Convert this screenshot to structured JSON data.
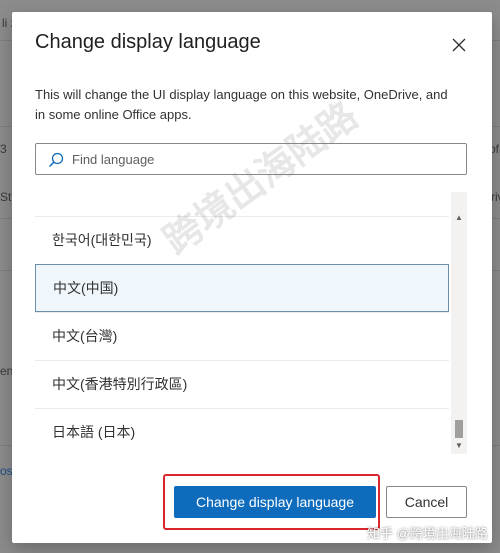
{
  "background": {
    "fragments": [
      "li z",
      "3",
      "Sta",
      "en",
      "os",
      "of",
      "riv"
    ]
  },
  "dialog": {
    "title": "Change display language",
    "description": "This will change the UI display language on this website, OneDrive, and in some online Office apps.",
    "search": {
      "placeholder": "Find language",
      "value": ""
    },
    "languages": [
      {
        "label": "한국어(대한민국)",
        "selected": false
      },
      {
        "label": "中文(中国)",
        "selected": true
      },
      {
        "label": "中文(台灣)",
        "selected": false
      },
      {
        "label": "中文(香港特別行政區)",
        "selected": false
      },
      {
        "label": "日本語 (日本)",
        "selected": false
      }
    ],
    "primary_button": "Change display language",
    "cancel_button": "Cancel"
  },
  "overlay": {
    "watermark": "跨境出海陆路",
    "credit": "知乎 @跨境出海陆路",
    "highlight_color": "#d9262b"
  },
  "colors": {
    "accent": "#0f6cbd",
    "selected_bg": "#eff6fc",
    "selected_border": "#6d8fae"
  },
  "icons": [
    "close-icon",
    "search-icon",
    "chevron-up-icon",
    "chevron-down-icon"
  ]
}
